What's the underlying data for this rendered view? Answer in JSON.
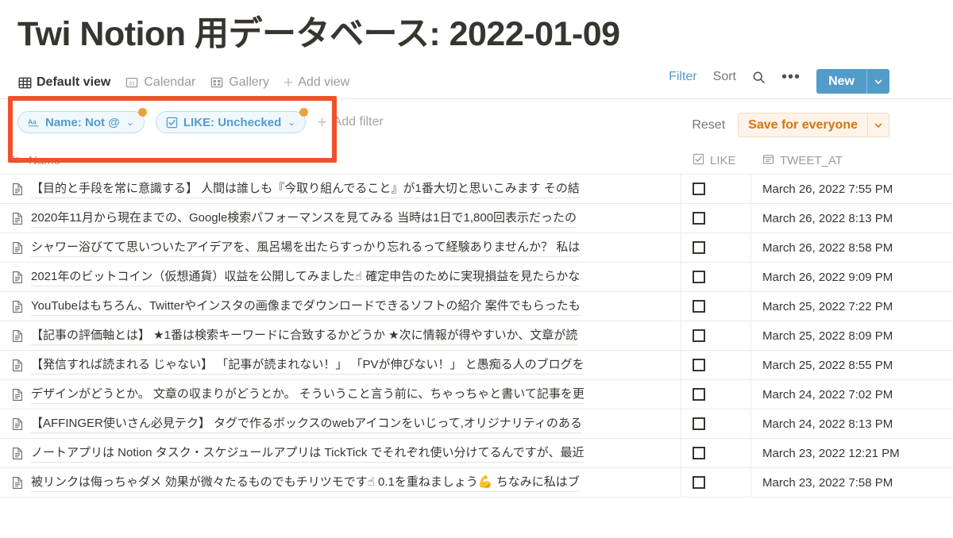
{
  "page": {
    "title": "Twi Notion 用データベース: 2022-01-09"
  },
  "views": {
    "tabs": [
      {
        "label": "Default view",
        "icon": "table-icon",
        "active": true
      },
      {
        "label": "Calendar",
        "icon": "calendar-icon",
        "active": false
      },
      {
        "label": "Gallery",
        "icon": "gallery-icon",
        "active": false
      }
    ],
    "add_view_label": "Add view"
  },
  "toolbar": {
    "filter_label": "Filter",
    "sort_label": "Sort",
    "search_icon": "search-icon",
    "more_icon": "ellipsis-icon",
    "new_label": "New",
    "new_caret": "⌄",
    "accent_color": "#529cca"
  },
  "filters": {
    "pills": [
      {
        "icon": "text-property-icon",
        "label": "Name: Not @",
        "caret": "⌄",
        "badge": true
      },
      {
        "icon": "checkbox-property-icon",
        "label": "LIKE: Unchecked",
        "caret": "⌄",
        "badge": true
      }
    ],
    "add_filter_label": "Add filter",
    "reset_label": "Reset",
    "save_label": "Save for everyone",
    "save_caret": "⌄",
    "badge_color": "#e9a33c",
    "save_color": "#d9730d"
  },
  "table": {
    "columns": [
      {
        "key": "name",
        "label": "Name",
        "icon": "text-property-icon"
      },
      {
        "key": "like",
        "label": "LIKE",
        "icon": "checkbox-property-icon"
      },
      {
        "key": "tweet_at",
        "label": "TWEET_AT",
        "icon": "date-property-icon"
      }
    ],
    "rows": [
      {
        "name": "【目的と手段を常に意識する】 人間は誰しも『今取り組んでること』が1番大切と思いこみます その結",
        "like": false,
        "tweet_at": "March 26, 2022 7:55 PM"
      },
      {
        "name": "2020年11月から現在までの、Google検索パフォーマンスを見てみる 当時は1日で1,800回表示だったの",
        "like": false,
        "tweet_at": "March 26, 2022 8:13 PM"
      },
      {
        "name": "シャワー浴びてて思いついたアイデアを、風呂場を出たらすっかり忘れるって経験ありませんか？ 私は",
        "like": false,
        "tweet_at": "March 26, 2022 8:58 PM"
      },
      {
        "name": "2021年のビットコイン（仮想通貨）収益を公開してみました☝ 確定申告のために実現損益を見たらかな",
        "like": false,
        "tweet_at": "March 26, 2022 9:09 PM"
      },
      {
        "name": "YouTubeはもちろん、Twitterやインスタの画像までダウンロードできるソフトの紹介 案件でもらったも",
        "like": false,
        "tweet_at": "March 25, 2022 7:22 PM"
      },
      {
        "name": "【記事の評価軸とは】 ★1番は検索キーワードに合致するかどうか ★次に情報が得やすいか、文章が読",
        "like": false,
        "tweet_at": "March 25, 2022 8:09 PM"
      },
      {
        "name": "【発信すれば読まれる じゃない】 「記事が読まれない！」 「PVが伸びない！」 と愚痴る人のブログを",
        "like": false,
        "tweet_at": "March 25, 2022 8:55 PM"
      },
      {
        "name": "デザインがどうとか。 文章の収まりがどうとか。 そういうこと言う前に、ちゃっちゃと書いて記事を更",
        "like": false,
        "tweet_at": "March 24, 2022 7:02 PM"
      },
      {
        "name": "【AFFINGER使いさん必見テク】 タグで作るボックスのwebアイコンをいじって,オリジナリティのある",
        "like": false,
        "tweet_at": "March 24, 2022 8:13 PM"
      },
      {
        "name": "ノートアプリは Notion タスク・スケジュールアプリは TickTick でそれぞれ使い分けてるんですが、最近",
        "like": false,
        "tweet_at": "March 23, 2022 12:21 PM"
      },
      {
        "name": "被リンクは侮っちゃダメ 効果が微々たるものでもチリツモです☝ 0.1を重ねましょう💪 ちなみに私はブ",
        "like": false,
        "tweet_at": "March 23, 2022 7:58 PM"
      }
    ]
  },
  "annotation": {
    "highlight_color": "#f0512a",
    "target": "filter-pills-region"
  }
}
